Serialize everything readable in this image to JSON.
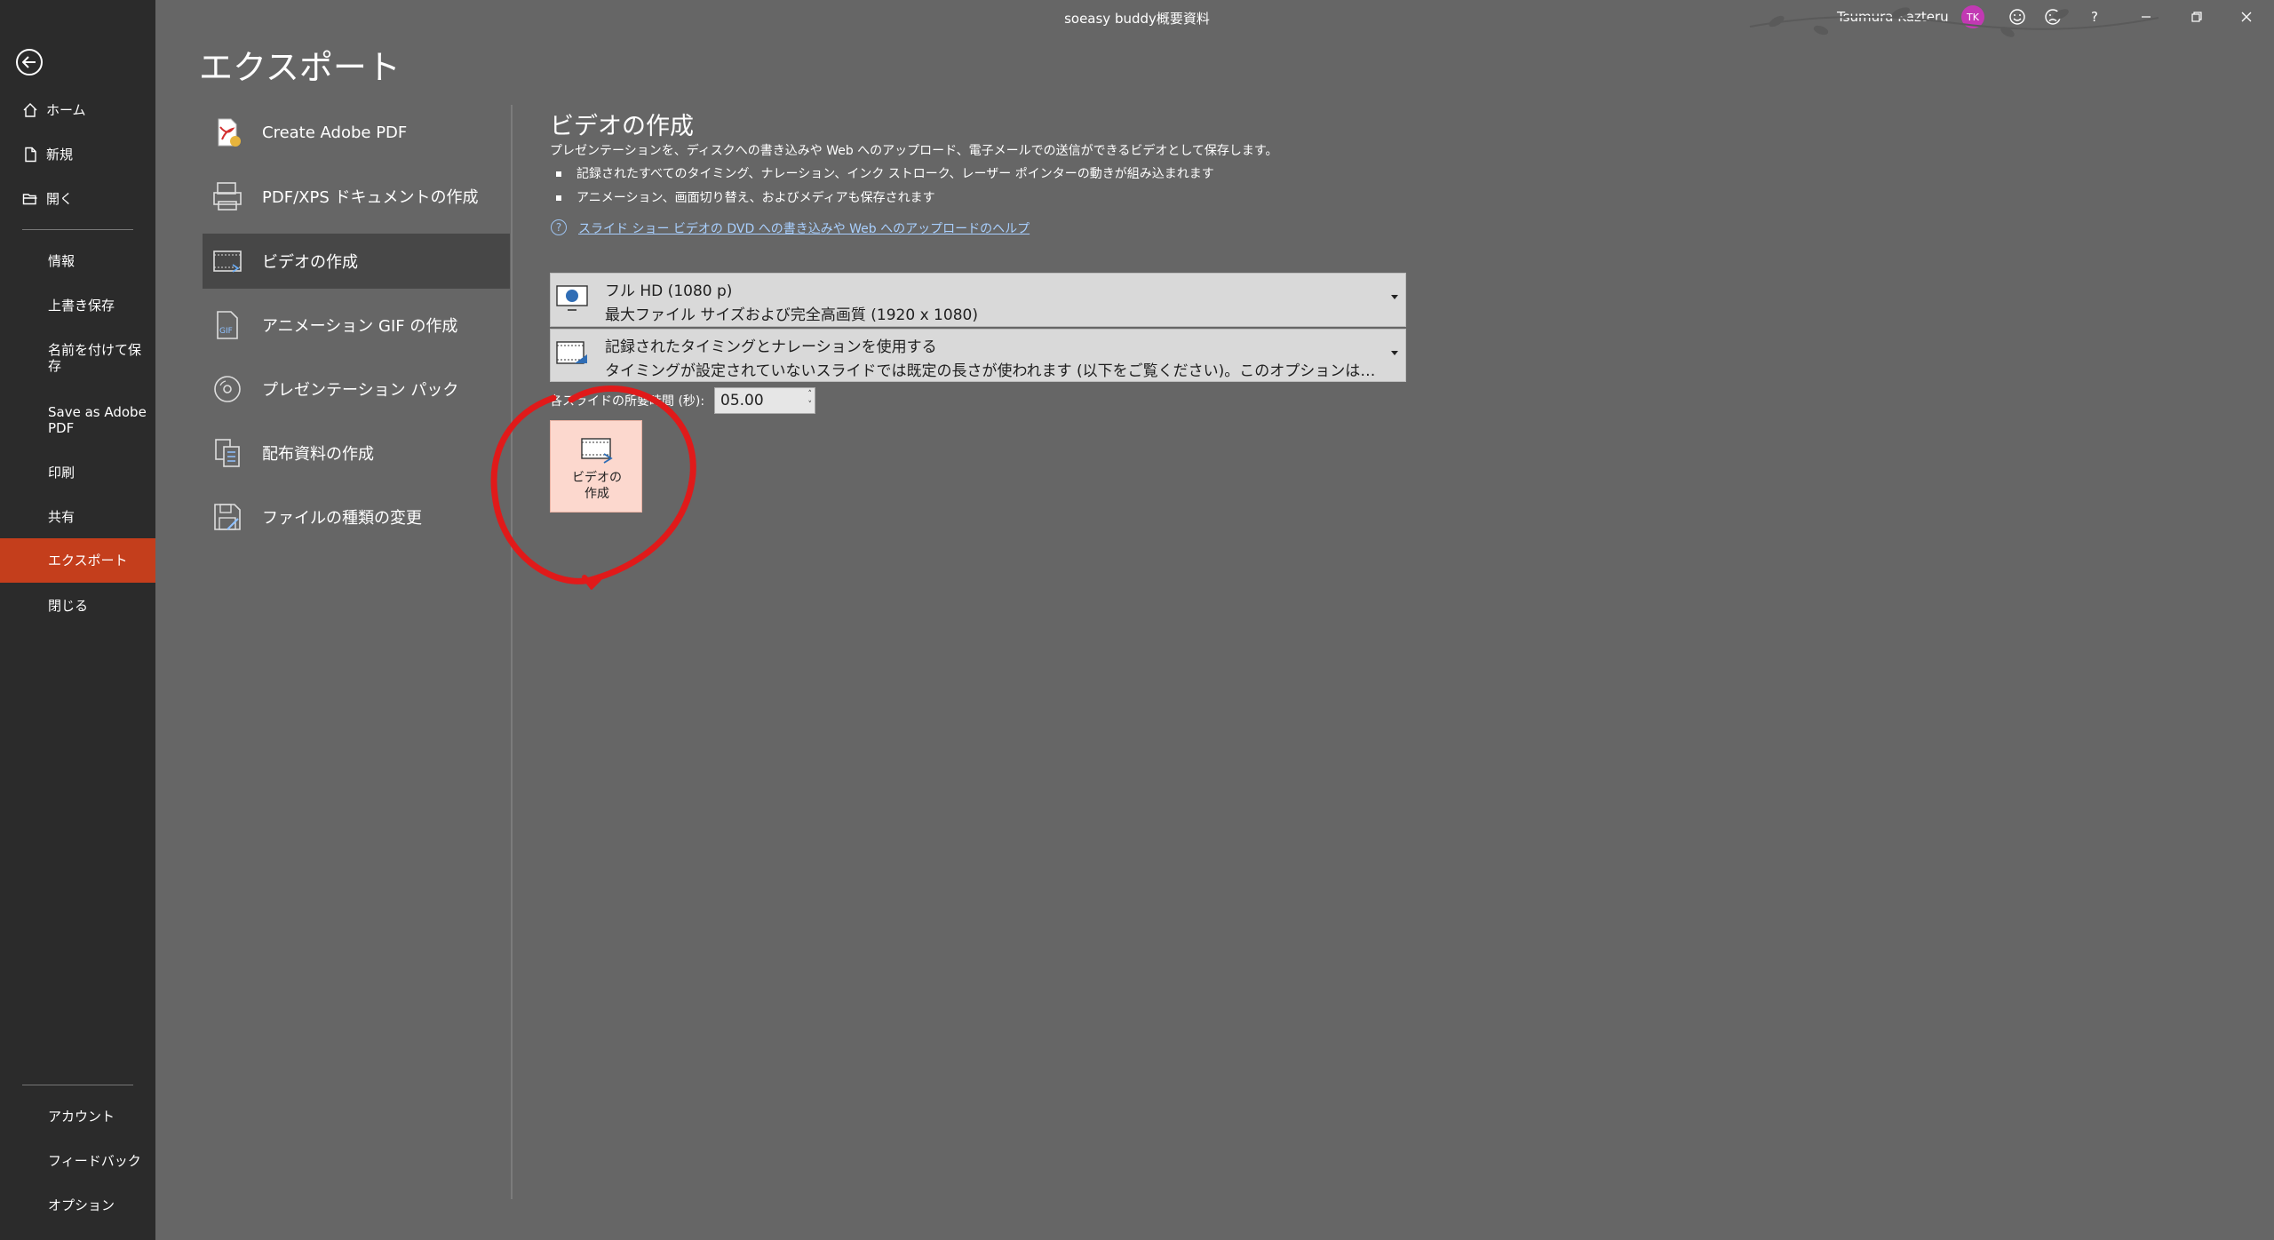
{
  "titlebar": {
    "doc_title": "soeasy buddy概要資料",
    "user_name": "Tsumura Kazteru",
    "avatar_initials": "TK",
    "help": "?"
  },
  "nav": {
    "top_items": [
      {
        "label": "ホーム",
        "icon": "home-icon"
      },
      {
        "label": "新規",
        "icon": "new-file-icon"
      },
      {
        "label": "開く",
        "icon": "open-folder-icon"
      }
    ],
    "mid_items": [
      "情報",
      "上書き保存",
      "名前を付けて保存",
      "Save as Adobe PDF",
      "印刷",
      "共有",
      "エクスポート",
      "閉じる"
    ],
    "bottom_items": [
      "アカウント",
      "フィードバック",
      "オプション"
    ]
  },
  "page": {
    "title": "エクスポート",
    "options": [
      "Create Adobe PDF",
      "PDF/XPS ドキュメントの作成",
      "ビデオの作成",
      "アニメーション GIF の作成",
      "プレゼンテーション パック",
      "配布資料の作成",
      "ファイルの種類の変更"
    ]
  },
  "video": {
    "title": "ビデオの作成",
    "description": "プレゼンテーションを、ディスクへの書き込みや Web へのアップロード、電子メールでの送信ができるビデオとして保存します。",
    "bullets": [
      "記録されたすべてのタイミング、ナレーション、インク ストローク、レーザー ポインターの動きが組み込まれます",
      "アニメーション、画面切り替え、およびメディアも保存されます"
    ],
    "help_link": "スライド ショー ビデオの DVD への書き込みや Web へのアップロードのヘルプ",
    "quality": {
      "line1": "フル HD (1080 p)",
      "line2": "最大ファイル サイズおよび完全高画質 (1920 x 1080)"
    },
    "timing": {
      "line1": "記録されたタイミングとナレーションを使用する",
      "line2": "タイミングが設定されていないスライドでは既定の長さが使われます (以下をご覧ください)。このオプションは、インクとレーザー ポインターの動きも含まれます"
    },
    "duration_label": "各スライドの所要時間 (秒):",
    "duration_value": "05.00",
    "create_button": "ビデオの作成"
  },
  "colors": {
    "nav_bg": "#2b2b2b",
    "main_bg": "#666666",
    "accent": "#c43e1c",
    "create_button_bg": "#fcd8ce",
    "annotation": "#e01a1a"
  }
}
